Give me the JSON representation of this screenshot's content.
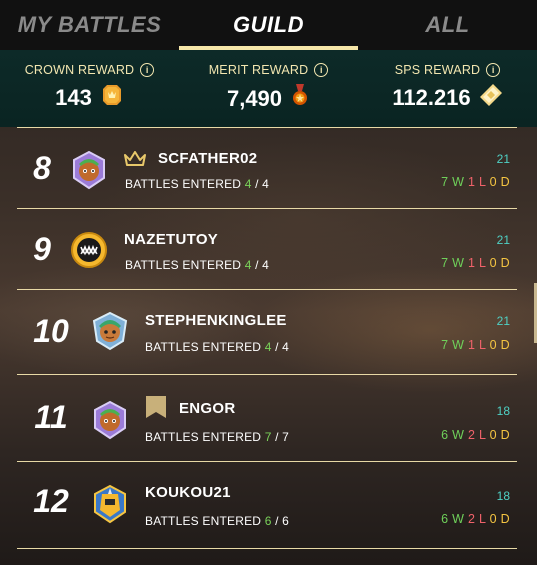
{
  "tabs": [
    {
      "label": "MY BATTLES",
      "active": false
    },
    {
      "label": "GUILD",
      "active": true
    },
    {
      "label": "ALL",
      "active": false
    }
  ],
  "rewards": {
    "crown": {
      "label": "CROWN REWARD",
      "value": "143",
      "icon": "crown-token-icon"
    },
    "merit": {
      "label": "MERIT REWARD",
      "value": "7,490",
      "icon": "merit-medal-icon"
    },
    "sps": {
      "label": "SPS REWARD",
      "value": "112.216",
      "icon": "sps-crystal-icon"
    }
  },
  "battles_label": "BATTLES ENTERED",
  "players": [
    {
      "rank": "8",
      "name": "SCFATHER02",
      "badge": "crown-icon",
      "entered": "4",
      "total": "4",
      "count": "21",
      "w": "7",
      "l": "1",
      "d": "0"
    },
    {
      "rank": "9",
      "name": "NAZETUTOY",
      "badge": "",
      "entered": "4",
      "total": "4",
      "count": "21",
      "w": "7",
      "l": "1",
      "d": "0"
    },
    {
      "rank": "10",
      "name": "STEPHENKINGLEE",
      "badge": "",
      "entered": "4",
      "total": "4",
      "count": "21",
      "w": "7",
      "l": "1",
      "d": "0"
    },
    {
      "rank": "11",
      "name": "ENGOR",
      "badge": "banner-icon",
      "entered": "7",
      "total": "7",
      "count": "18",
      "w": "6",
      "l": "2",
      "d": "0"
    },
    {
      "rank": "12",
      "name": "KOUKOU21",
      "badge": "",
      "entered": "6",
      "total": "6",
      "count": "18",
      "w": "6",
      "l": "2",
      "d": "0"
    }
  ],
  "colors": {
    "accent": "#f5e6a8",
    "rewards_bg": "#0d2a28",
    "win": "#6fd05a",
    "loss": "#f0626a",
    "draw": "#f5c542",
    "count": "#4fd1c5"
  }
}
